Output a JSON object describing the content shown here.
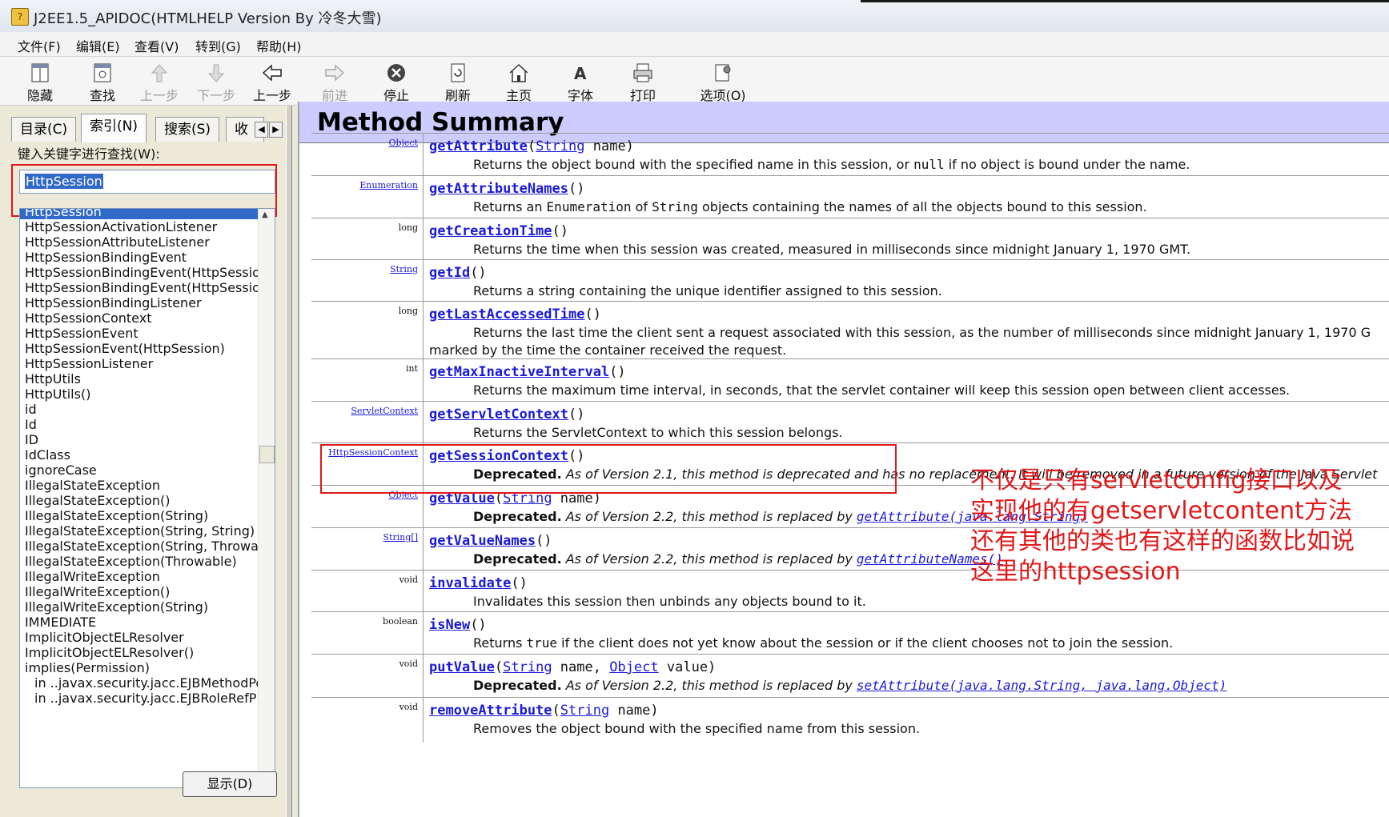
{
  "window": {
    "title": "J2EE1.5_APIDOC(HTMLHELP Version By 冷冬大雪)"
  },
  "menu": [
    "文件(F)",
    "编辑(E)",
    "查看(V)",
    "转到(G)",
    "帮助(H)"
  ],
  "toolbar": [
    {
      "label": "隐藏",
      "icon": "hide-icon"
    },
    {
      "label": "查找",
      "icon": "find-icon"
    },
    {
      "label": "上一步",
      "icon": "up-arrow-icon",
      "disabled": true
    },
    {
      "label": "下一步",
      "icon": "down-arrow-icon",
      "disabled": true
    },
    {
      "label": "上一步",
      "icon": "back-arrow-icon"
    },
    {
      "label": "前进",
      "icon": "forward-arrow-icon",
      "disabled": true
    },
    {
      "label": "停止",
      "icon": "stop-icon"
    },
    {
      "label": "刷新",
      "icon": "refresh-icon"
    },
    {
      "label": "主页",
      "icon": "home-icon"
    },
    {
      "label": "字体",
      "icon": "font-icon"
    },
    {
      "label": "打印",
      "icon": "print-icon"
    },
    {
      "label": "选项(O)",
      "icon": "options-icon"
    }
  ],
  "left": {
    "tabs": [
      "目录(C)",
      "索引(N)",
      "搜索(S)",
      "收藏"
    ],
    "keyword_label": "键入关键字进行查找(W):",
    "keyword_value": "HttpSession",
    "show_button": "显示(D)",
    "items": [
      "HttpSession",
      "HttpSessionActivationListener",
      "HttpSessionAttributeListener",
      "HttpSessionBindingEvent",
      "HttpSessionBindingEvent(HttpSessio",
      "HttpSessionBindingEvent(HttpSessio",
      "HttpSessionBindingListener",
      "HttpSessionContext",
      "HttpSessionEvent",
      "HttpSessionEvent(HttpSession)",
      "HttpSessionListener",
      "HttpUtils",
      "HttpUtils()",
      "id",
      "Id",
      "ID",
      "IdClass",
      "ignoreCase",
      "IllegalStateException",
      "IllegalStateException()",
      "IllegalStateException(String)",
      "IllegalStateException(String, String)",
      "IllegalStateException(String, Throwab",
      "IllegalStateException(Throwable)",
      "IllegalWriteException",
      "IllegalWriteException()",
      "IllegalWriteException(String)",
      "IMMEDIATE",
      "ImplicitObjectELResolver",
      "ImplicitObjectELResolver()",
      "implies(Permission)",
      "in ..javax.security.jacc.EJBMethodPe",
      "in ..javax.security.jacc.EJBRoleRefP"
    ]
  },
  "right": {
    "header": "Method Summary",
    "rows": [
      {
        "type": "Object",
        "type_link": true,
        "method": "getAttribute",
        "params": "(<p>String</p> name)",
        "desc": "Returns the object bound with the specified name in this session, or <c>null</c> if no object is bound under the name."
      },
      {
        "type": "Enumeration",
        "type_link": true,
        "method": "getAttributeNames",
        "params": "()",
        "desc": "Returns an <c>Enumeration</c> of <c>String</c> objects containing the names of all the objects bound to this session."
      },
      {
        "type": "long",
        "type_link": false,
        "method": "getCreationTime",
        "params": "()",
        "desc": "Returns the time when this session was created, measured in milliseconds since midnight January 1, 1970 GMT."
      },
      {
        "type": "String",
        "type_link": true,
        "method": "getId",
        "params": "()",
        "desc": "Returns a string containing the unique identifier assigned to this session."
      },
      {
        "type": "long",
        "type_link": false,
        "method": "getLastAccessedTime",
        "params": "()",
        "desc": "Returns the last time the client sent a request associated with this session, as the number of milliseconds since midnight January 1, 1970 G",
        "desc2": "marked by the time the container received the request."
      },
      {
        "type": "int",
        "type_link": false,
        "method": "getMaxInactiveInterval",
        "params": "()",
        "desc": "Returns the maximum time interval, in seconds, that the servlet container will keep this session open between client accesses."
      },
      {
        "type": "ServletContext",
        "type_link": true,
        "method": "getServletContext",
        "params": "()",
        "desc": "Returns the ServletContext to which this session belongs."
      },
      {
        "type": "HttpSessionContext",
        "type_link": true,
        "method": "getSessionContext",
        "params": "()",
        "desc": "<b>Deprecated.</b> <i>As of Version 2.1, this method is deprecated and has no replacement. It will be removed in a future version of the Java Servlet</i>"
      },
      {
        "type": "Object",
        "type_link": true,
        "method": "getValue",
        "params": "(<p>String</p> name)",
        "desc": "<b>Deprecated.</b> <i>As of Version 2.2, this method is replaced by</i> <l>getAttribute(java.lang.String)</l>"
      },
      {
        "type": "String[]",
        "type_link": true,
        "method": "getValueNames",
        "params": "()",
        "desc": "<b>Deprecated.</b> <i>As of Version 2.2, this method is replaced by</i> <l>getAttributeNames()</l>"
      },
      {
        "type": "void",
        "type_link": false,
        "method": "invalidate",
        "params": "()",
        "desc": "Invalidates this session then unbinds any objects bound to it."
      },
      {
        "type": "boolean",
        "type_link": false,
        "method": "isNew",
        "params": "()",
        "desc": "Returns <c>true</c> if the client does not yet know about the session or if the client chooses not to join the session."
      },
      {
        "type": "void",
        "type_link": false,
        "method": "putValue",
        "params": "(<p>String</p> name, <p>Object</p> value)",
        "desc": "<b>Deprecated.</b> <i>As of Version 2.2, this method is replaced by</i> <l>setAttribute(java.lang.String, java.lang.Object)</l>"
      },
      {
        "type": "void",
        "type_link": false,
        "method": "removeAttribute",
        "params": "(<p>String</p> name)",
        "desc": "Removes the object bound with the specified name from this session."
      }
    ]
  },
  "annotation": [
    "不仅是只有servletconfig接口以及",
    "实现他的有getservletcontent方法",
    "还有其他的类也有这样的函数比如说",
    "这里的httpsession"
  ],
  "colors": {
    "header_bg": "#ccccff",
    "link": "#1a1ad8",
    "annotation": "#e0191b",
    "selection": "#3169c6"
  }
}
